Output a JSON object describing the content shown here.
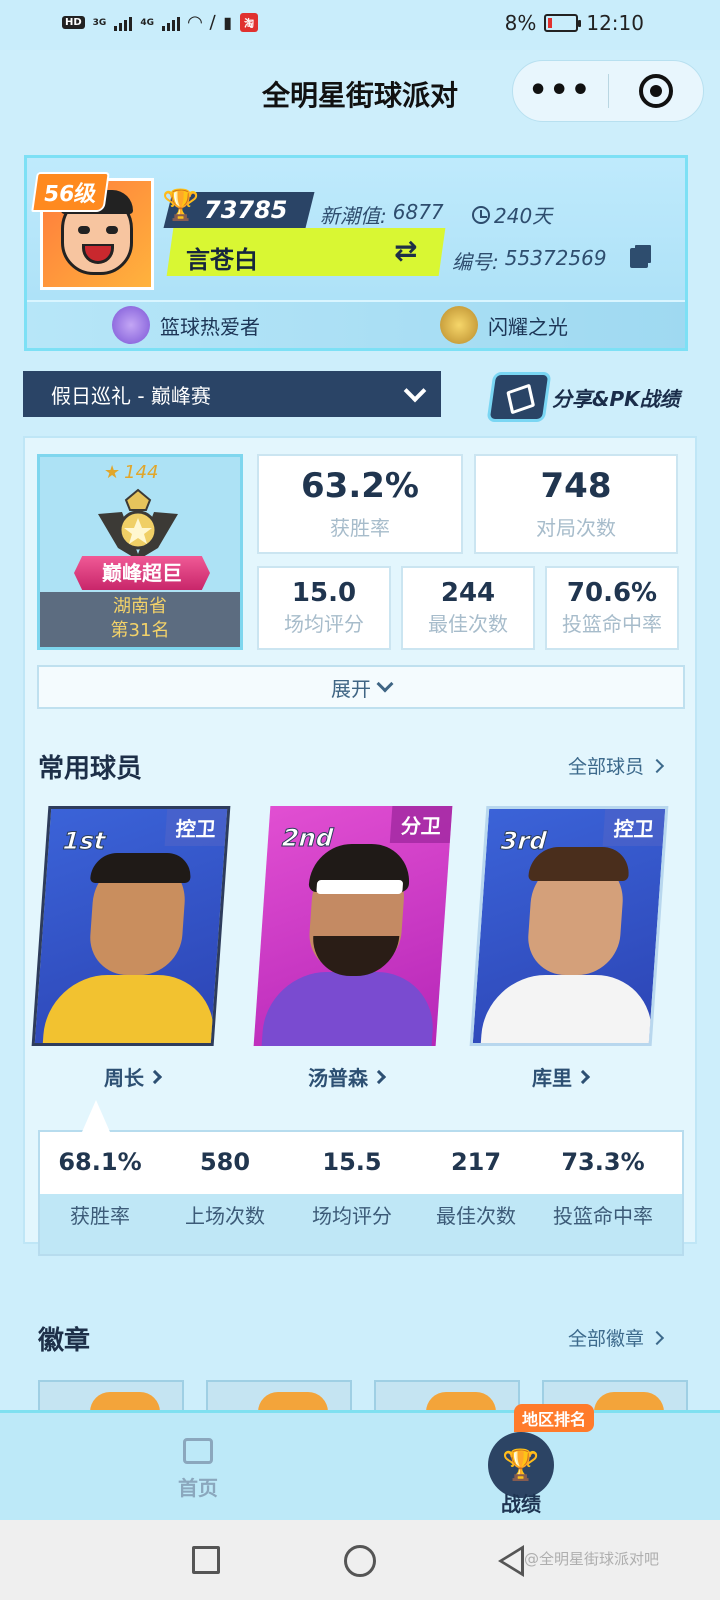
{
  "status_bar": {
    "network_label": "HD",
    "sig1": "3G",
    "sig2": "4G",
    "battery_text": "8%",
    "time": "12:10"
  },
  "header": {
    "title": "全明星街球派对",
    "more_icon": "more-dots-icon",
    "close_icon": "target-circle-icon"
  },
  "profile": {
    "level": "56级",
    "trophies": "73785",
    "trend_label": "新潮值:",
    "trend_value": "6877",
    "days": "240天",
    "name": "言苍白",
    "uid_label": "编号:",
    "uid": "55372569",
    "titles": [
      "篮球热爱者",
      "闪耀之光"
    ]
  },
  "season": {
    "selected": "假日巡礼 - 巅峰赛",
    "share_label": "分享&PK战绩"
  },
  "rank": {
    "stars": "144",
    "tier": "巅峰超巨",
    "region": "湖南省",
    "position": "第31名"
  },
  "stats": [
    {
      "value": "63.2%",
      "label": "获胜率"
    },
    {
      "value": "748",
      "label": "对局次数"
    },
    {
      "value": "15.0",
      "label": "场均评分"
    },
    {
      "value": "244",
      "label": "最佳次数"
    },
    {
      "value": "70.6%",
      "label": "投篮命中率"
    }
  ],
  "expand_label": "展开",
  "players_section": {
    "title": "常用球员",
    "link": "全部球员",
    "players": [
      {
        "rank": "1st",
        "position": "控卫",
        "name": "周长"
      },
      {
        "rank": "2nd",
        "position": "分卫",
        "name": "汤普森"
      },
      {
        "rank": "3rd",
        "position": "控卫",
        "name": "库里"
      }
    ],
    "selected_stats": [
      {
        "value": "68.1%",
        "label": "获胜率"
      },
      {
        "value": "580",
        "label": "上场次数"
      },
      {
        "value": "15.5",
        "label": "场均评分"
      },
      {
        "value": "217",
        "label": "最佳次数"
      },
      {
        "value": "73.3%",
        "label": "投篮命中率"
      }
    ]
  },
  "badges_section": {
    "title": "徽章",
    "link": "全部徽章"
  },
  "bottom_nav": {
    "home": "首页",
    "stats": "战绩",
    "region_tag": "地区排名"
  },
  "watermark": "@全明星街球派对吧",
  "colors": {
    "background": "#cdeefb",
    "navy": "#2a4466",
    "lime": "#d9f733",
    "orange": "#ff7b2b",
    "pink": "#e03a86"
  }
}
